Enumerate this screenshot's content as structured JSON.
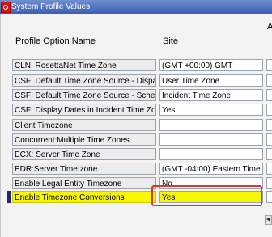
{
  "window": {
    "title": "System Profile Values"
  },
  "headers": {
    "profile_option_name": "Profile Option Name",
    "site": "Site",
    "next_column_partial": "A"
  },
  "rows": [
    {
      "name": "CLN: RosettaNet Time Zone",
      "site": "(GMT +00:00) GMT"
    },
    {
      "name": "CSF: Default Time Zone Source - Dispatch",
      "site": "User Time Zone"
    },
    {
      "name": "CSF: Default Time Zone Source - Schedule",
      "site": "Incident Time Zone"
    },
    {
      "name": "CSF: Display Dates in Incident Time Zone",
      "site": "Yes"
    },
    {
      "name": "Client Timezone",
      "site": ""
    },
    {
      "name": "Concurrent:Multiple Time Zones",
      "site": ""
    },
    {
      "name": "ECX: Server Time Zone",
      "site": ""
    },
    {
      "name": "EDR:Server Time zone",
      "site": "(GMT -04:00) Eastern Time"
    },
    {
      "name": "Enable Legal Entity Timezone",
      "site": "No"
    },
    {
      "name": "Enable Timezone Conversions",
      "site": "Yes",
      "selected": true
    }
  ],
  "icons": {
    "app": "oracle-logo-icon",
    "scroll": "scroll-left-arrow-icon"
  },
  "colors": {
    "highlight": "#f7f700",
    "annotation_box": "#d9382a",
    "title_bar": "#3c5fb0"
  }
}
